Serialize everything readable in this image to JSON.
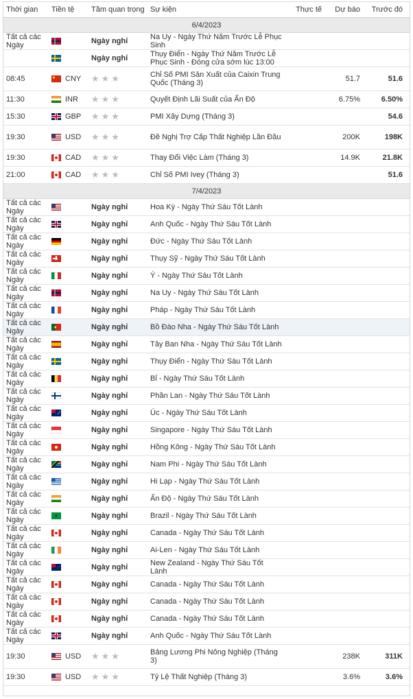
{
  "headers": {
    "time": "Thời gian",
    "currency": "Tiền tệ",
    "importance": "Tầm quan trọng",
    "event": "Sự kiện",
    "actual": "Thực tế",
    "forecast": "Dự báo",
    "previous": "Trước đó"
  },
  "holiday_label": "Ngày nghỉ",
  "sections": [
    {
      "date": "6/4/2023",
      "rows": [
        {
          "time": "Tất cả các Ngày",
          "flag": "no",
          "currency": "",
          "importance": "holiday",
          "event": "Na Uy - Ngày Thứ Năm Trước Lễ Phục Sinh",
          "actual": "",
          "forecast": "",
          "previous": ""
        },
        {
          "time": "",
          "flag": "se",
          "currency": "",
          "importance": "holiday",
          "event": "Thụy Điển - Ngày Thứ Năm Trước Lễ Phục Sinh - Đóng cửa sớm lúc 13:00",
          "actual": "",
          "forecast": "",
          "previous": ""
        },
        {
          "time": "08:45",
          "flag": "cn",
          "currency": "CNY",
          "importance": "★★★",
          "event": "Chỉ Số PMI Sản Xuất của Caixin Trung Quốc (Tháng 3)",
          "actual": "",
          "forecast": "51.7",
          "previous": "51.6",
          "tall": true
        },
        {
          "time": "11:30",
          "flag": "in",
          "currency": "INR",
          "importance": "★★★",
          "event": "Quyết Định Lãi Suất của Ấn Độ",
          "actual": "",
          "forecast": "6.75%",
          "previous": "6.50%"
        },
        {
          "time": "15:30",
          "flag": "gb",
          "currency": "GBP",
          "importance": "★★★",
          "event": "PMI Xây Dựng (Tháng 3)",
          "actual": "",
          "forecast": "",
          "previous": "54.6"
        },
        {
          "time": "19:30",
          "flag": "us",
          "currency": "USD",
          "importance": "★★★",
          "event": "Đề Nghị Trợ Cấp Thất Nghiệp Lần Đầu",
          "actual": "",
          "forecast": "200K",
          "previous": "198K",
          "tall": true
        },
        {
          "time": "19:30",
          "flag": "ca",
          "currency": "CAD",
          "importance": "★★★",
          "event": "Thay Đổi Việc Làm (Tháng 3)",
          "actual": "",
          "forecast": "14.9K",
          "previous": "21.8K"
        },
        {
          "time": "21:00",
          "flag": "ca",
          "currency": "CAD",
          "importance": "★★★",
          "event": "Chỉ Số PMI Ivey (Tháng 3)",
          "actual": "",
          "forecast": "",
          "previous": "51.6"
        }
      ]
    },
    {
      "date": "7/4/2023",
      "rows": [
        {
          "time": "Tất cả các Ngày",
          "flag": "us",
          "currency": "",
          "importance": "holiday",
          "event": "Hoa Kỳ - Ngày Thứ Sáu Tốt Lành",
          "actual": "",
          "forecast": "",
          "previous": ""
        },
        {
          "time": "Tất cả các Ngày",
          "flag": "gb",
          "currency": "",
          "importance": "holiday",
          "event": "Anh Quốc - Ngày Thứ Sáu Tốt Lành",
          "actual": "",
          "forecast": "",
          "previous": ""
        },
        {
          "time": "Tất cả các Ngày",
          "flag": "de",
          "currency": "",
          "importance": "holiday",
          "event": "Đức - Ngày Thứ Sáu Tốt Lành",
          "actual": "",
          "forecast": "",
          "previous": ""
        },
        {
          "time": "Tất cả các Ngày",
          "flag": "ch",
          "currency": "",
          "importance": "holiday",
          "event": "Thụy Sỹ - Ngày Thứ Sáu Tốt Lành",
          "actual": "",
          "forecast": "",
          "previous": ""
        },
        {
          "time": "Tất cả các Ngày",
          "flag": "it",
          "currency": "",
          "importance": "holiday",
          "event": "Ý - Ngày Thứ Sáu Tốt Lành",
          "actual": "",
          "forecast": "",
          "previous": ""
        },
        {
          "time": "Tất cả các Ngày",
          "flag": "no",
          "currency": "",
          "importance": "holiday",
          "event": "Na Uy - Ngày Thứ Sáu Tốt Lành",
          "actual": "",
          "forecast": "",
          "previous": ""
        },
        {
          "time": "Tất cả các Ngày",
          "flag": "fr",
          "currency": "",
          "importance": "holiday",
          "event": "Pháp - Ngày Thứ Sáu Tốt Lành",
          "actual": "",
          "forecast": "",
          "previous": ""
        },
        {
          "time": "Tất cả các Ngày",
          "flag": "pt",
          "currency": "",
          "importance": "holiday",
          "event": "Bồ Đào Nha - Ngày Thứ Sáu Tốt Lành",
          "actual": "",
          "forecast": "",
          "previous": "",
          "highlight": true
        },
        {
          "time": "Tất cả các Ngày",
          "flag": "es",
          "currency": "",
          "importance": "holiday",
          "event": "Tây Ban Nha - Ngày Thứ Sáu Tốt Lành",
          "actual": "",
          "forecast": "",
          "previous": ""
        },
        {
          "time": "Tất cả các Ngày",
          "flag": "se",
          "currency": "",
          "importance": "holiday",
          "event": "Thụy Điển - Ngày Thứ Sáu Tốt Lành",
          "actual": "",
          "forecast": "",
          "previous": ""
        },
        {
          "time": "Tất cả các Ngày",
          "flag": "be",
          "currency": "",
          "importance": "holiday",
          "event": "Bỉ - Ngày Thứ Sáu Tốt Lành",
          "actual": "",
          "forecast": "",
          "previous": ""
        },
        {
          "time": "Tất cả các Ngày",
          "flag": "fi",
          "currency": "",
          "importance": "holiday",
          "event": "Phần Lan - Ngày Thứ Sáu Tốt Lành",
          "actual": "",
          "forecast": "",
          "previous": ""
        },
        {
          "time": "Tất cả các Ngày",
          "flag": "au",
          "currency": "",
          "importance": "holiday",
          "event": "Úc - Ngày Thứ Sáu Tốt Lành",
          "actual": "",
          "forecast": "",
          "previous": ""
        },
        {
          "time": "Tất cả các Ngày",
          "flag": "sg",
          "currency": "",
          "importance": "holiday",
          "event": "Singapore - Ngày Thứ Sáu Tốt Lành",
          "actual": "",
          "forecast": "",
          "previous": ""
        },
        {
          "time": "Tất cả các Ngày",
          "flag": "hk",
          "currency": "",
          "importance": "holiday",
          "event": "Hồng Kông - Ngày Thứ Sáu Tốt Lành",
          "actual": "",
          "forecast": "",
          "previous": ""
        },
        {
          "time": "Tất cả các Ngày",
          "flag": "za",
          "currency": "",
          "importance": "holiday",
          "event": "Nam Phi - Ngày Thứ Sáu Tốt Lành",
          "actual": "",
          "forecast": "",
          "previous": ""
        },
        {
          "time": "Tất cả các Ngày",
          "flag": "gr",
          "currency": "",
          "importance": "holiday",
          "event": "Hi Lạp - Ngày Thứ Sáu Tốt Lành",
          "actual": "",
          "forecast": "",
          "previous": ""
        },
        {
          "time": "Tất cả các Ngày",
          "flag": "in",
          "currency": "",
          "importance": "holiday",
          "event": "Ấn Độ - Ngày Thứ Sáu Tốt Lành",
          "actual": "",
          "forecast": "",
          "previous": ""
        },
        {
          "time": "Tất cả các Ngày",
          "flag": "br",
          "currency": "",
          "importance": "holiday",
          "event": "Brazil - Ngày Thứ Sáu Tốt Lành",
          "actual": "",
          "forecast": "",
          "previous": ""
        },
        {
          "time": "Tất cả các Ngày",
          "flag": "ca",
          "currency": "",
          "importance": "holiday",
          "event": "Canada - Ngày Thứ Sáu Tốt Lành",
          "actual": "",
          "forecast": "",
          "previous": ""
        },
        {
          "time": "Tất cả các Ngày",
          "flag": "ie",
          "currency": "",
          "importance": "holiday",
          "event": "Ai-Len - Ngày Thứ Sáu Tốt Lành",
          "actual": "",
          "forecast": "",
          "previous": ""
        },
        {
          "time": "Tất cả các Ngày",
          "flag": "nz",
          "currency": "",
          "importance": "holiday",
          "event": "New Zealand - Ngày Thứ Sáu Tốt Lành",
          "actual": "",
          "forecast": "",
          "previous": ""
        },
        {
          "time": "Tất cả các Ngày",
          "flag": "ca",
          "currency": "",
          "importance": "holiday",
          "event": "Canada - Ngày Thứ Sáu Tốt Lành",
          "actual": "",
          "forecast": "",
          "previous": ""
        },
        {
          "time": "Tất cả các Ngày",
          "flag": "ca",
          "currency": "",
          "importance": "holiday",
          "event": "Canada - Ngày Thứ Sáu Tốt Lành",
          "actual": "",
          "forecast": "",
          "previous": ""
        },
        {
          "time": "Tất cả các Ngày",
          "flag": "ca",
          "currency": "",
          "importance": "holiday",
          "event": "Canada - Ngày Thứ Sáu Tốt Lành",
          "actual": "",
          "forecast": "",
          "previous": ""
        },
        {
          "time": "Tất cả các Ngày",
          "flag": "gb",
          "currency": "",
          "importance": "holiday",
          "event": "Anh Quốc - Ngày Thứ Sáu Tốt Lành",
          "actual": "",
          "forecast": "",
          "previous": ""
        },
        {
          "time": "19:30",
          "flag": "us",
          "currency": "USD",
          "importance": "★★★",
          "event": "Bảng Lương Phi Nông Nghiệp (Tháng 3)",
          "actual": "",
          "forecast": "238K",
          "previous": "311K",
          "tall": true
        },
        {
          "time": "19:30",
          "flag": "us",
          "currency": "USD",
          "importance": "★★★",
          "event": "Tỷ Lệ Thất Nghiệp (Tháng 3)",
          "actual": "",
          "forecast": "3.6%",
          "previous": "3.6%"
        }
      ]
    }
  ]
}
